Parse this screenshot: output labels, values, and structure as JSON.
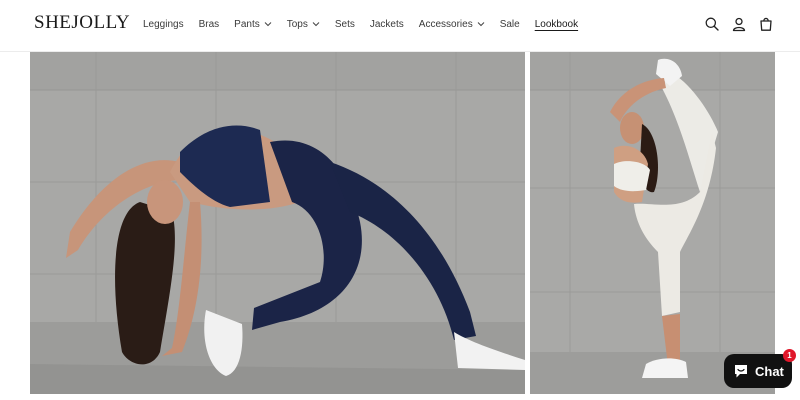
{
  "brand": {
    "logo_text": "SHEJOLLY"
  },
  "nav": {
    "items": [
      {
        "label": "Leggings",
        "has_dropdown": false
      },
      {
        "label": "Bras",
        "has_dropdown": false
      },
      {
        "label": "Pants",
        "has_dropdown": true
      },
      {
        "label": "Tops",
        "has_dropdown": true
      },
      {
        "label": "Sets",
        "has_dropdown": false
      },
      {
        "label": "Jackets",
        "has_dropdown": false
      },
      {
        "label": "Accessories",
        "has_dropdown": true
      },
      {
        "label": "Sale",
        "has_dropdown": false
      },
      {
        "label": "Lookbook",
        "has_dropdown": false,
        "active": true
      }
    ]
  },
  "header_icons": [
    "search-icon",
    "account-icon",
    "cart-icon"
  ],
  "lookbook": {
    "images": [
      {
        "subject": "model in navy sports bra and navy leggings in a backbend pose"
      },
      {
        "subject": "model in white crop top and white leggings in a standing split pose"
      }
    ]
  },
  "chat": {
    "label": "Chat",
    "badge": "1"
  },
  "colors": {
    "accent": "#111111",
    "badge": "#e0172a",
    "wall": "#a9a9a7"
  }
}
